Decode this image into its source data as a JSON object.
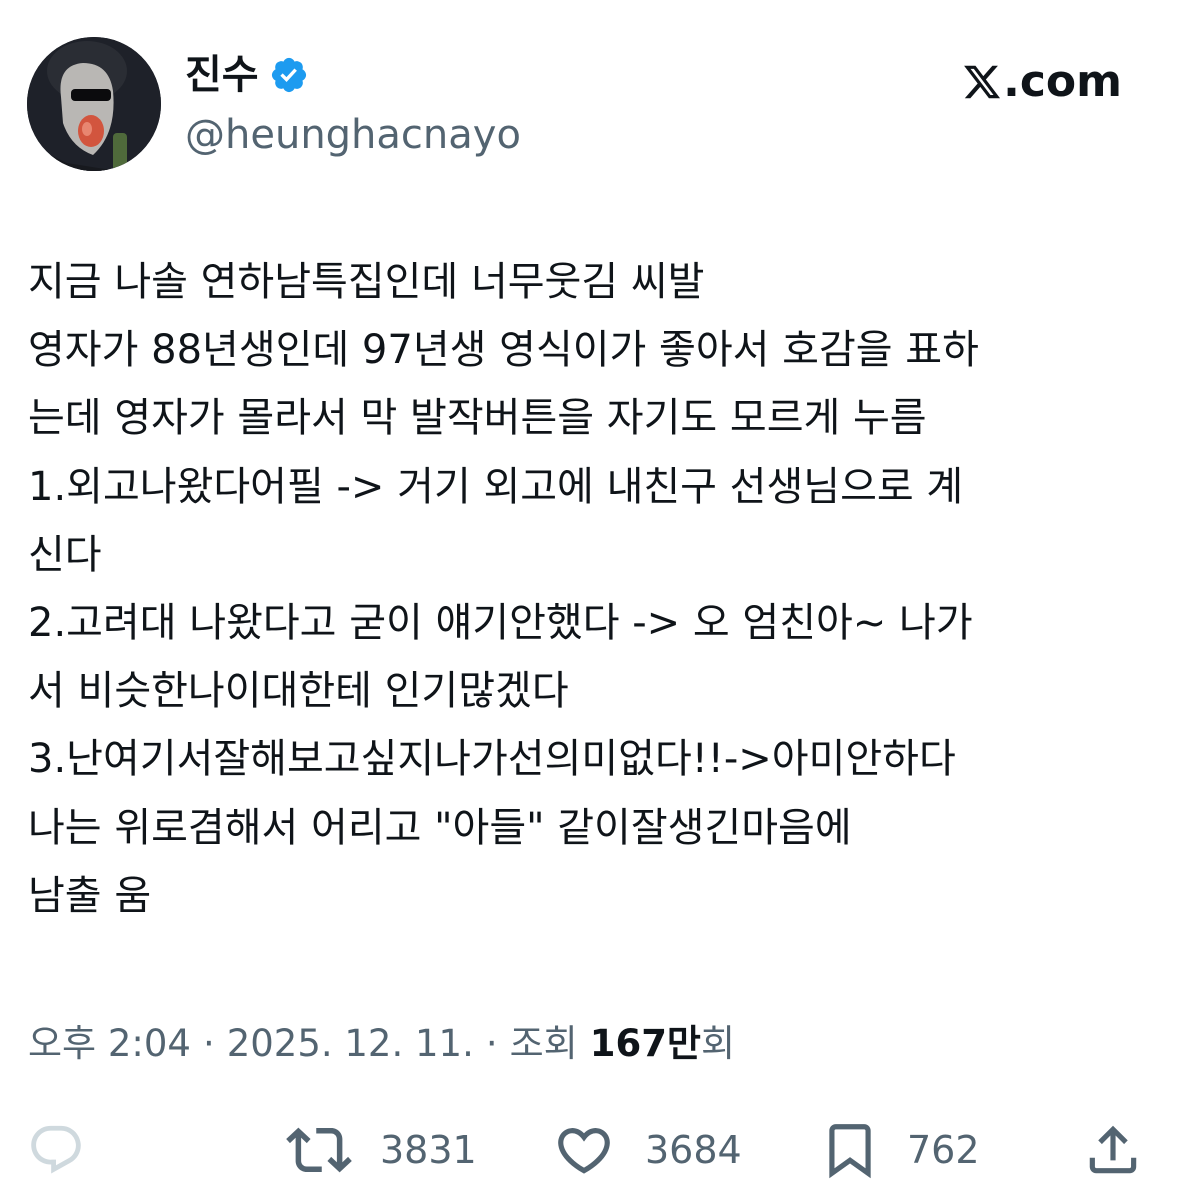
{
  "author": {
    "display_name": "진수",
    "handle": "@heunghacnayo",
    "verified": true,
    "verified_color": "#1d9bf0"
  },
  "brand": {
    "logo_icon": "x-logo-icon",
    "suffix": ".com"
  },
  "tweet": {
    "lines": [
      "지금 나솔 연하남특집인데 너무웃김 씨발",
      "영자가 88년생인데 97년생 영식이가 좋아서 호감을 표하",
      "는데 영자가 몰라서 막 발작버튼을 자기도 모르게 누름",
      "1.외고나왔다어필 -> 거기 외고에 내친구 선생님으로 계",
      "신다",
      "2.고려대 나왔다고 굳이 얘기안했다 -> 오 엄친아~ 나가",
      "서 비슷한나이대한테 인기많겠다",
      "3.난여기서잘해보고싶지나가선의미없다!!->아미안하다",
      "나는 위로겸해서 어리고 \"아들\" 같이잘생긴마음에",
      "남출 움"
    ]
  },
  "meta": {
    "time": "오후 2:04",
    "separator": "·",
    "date": "2025. 12. 11.",
    "views_label": "조회",
    "views_count": "167만",
    "views_suffix": "회"
  },
  "actions": {
    "reply_icon": "reply-icon",
    "retweet_icon": "retweet-icon",
    "retweets": "3831",
    "like_icon": "heart-icon",
    "likes": "3684",
    "bookmark_icon": "bookmark-icon",
    "bookmarks": "762",
    "share_icon": "share-icon"
  },
  "colors": {
    "text_primary": "#0f1419",
    "text_secondary": "#536471",
    "reply_icon_muted": "#cfd9de"
  }
}
